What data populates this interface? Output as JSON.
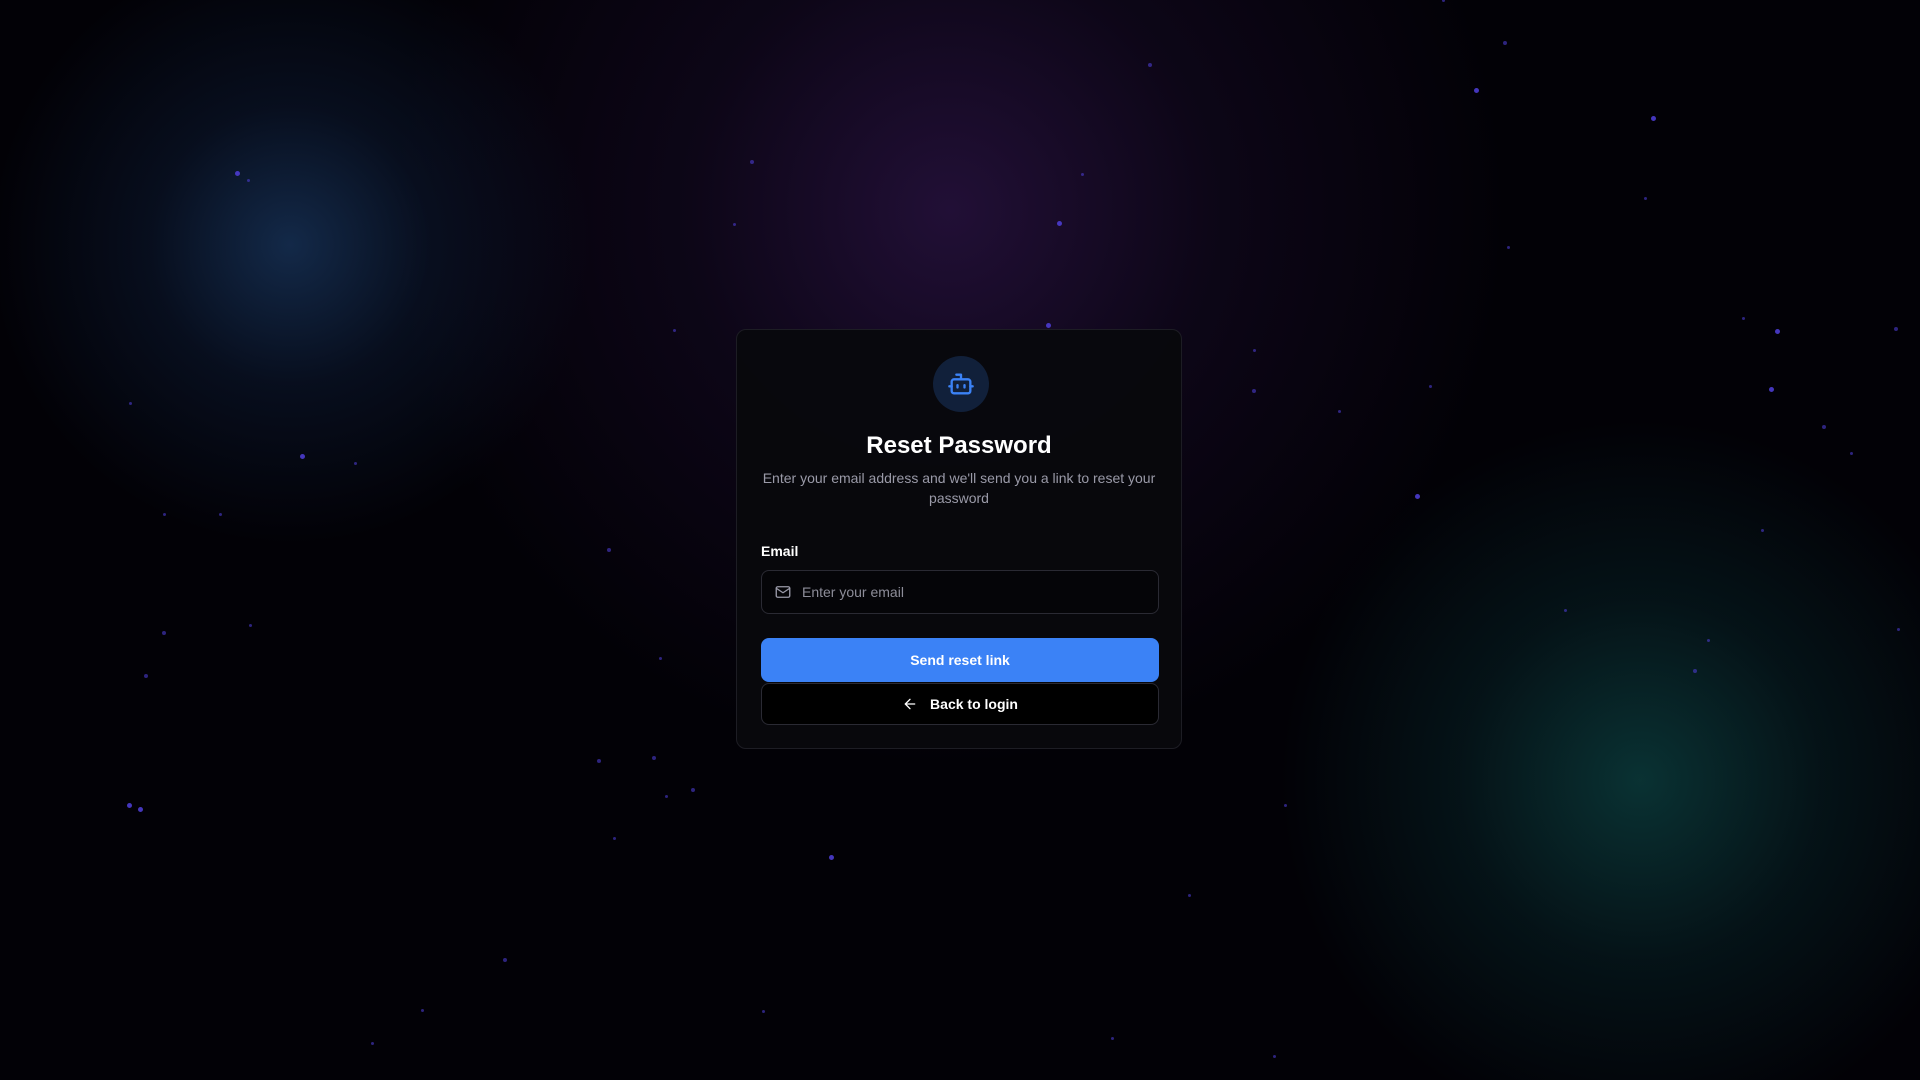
{
  "card": {
    "title": "Reset Password",
    "subtitle": "Enter your email address and we'll send you a link to reset your password",
    "logo_icon": "bot-icon",
    "accent_color": "#3b82f6"
  },
  "form": {
    "email_label": "Email",
    "email_value": "",
    "email_placeholder": "Enter your email",
    "email_icon": "mail-icon",
    "submit_label": "Send reset link",
    "back_label": "Back to login",
    "back_icon": "arrow-left-icon"
  }
}
